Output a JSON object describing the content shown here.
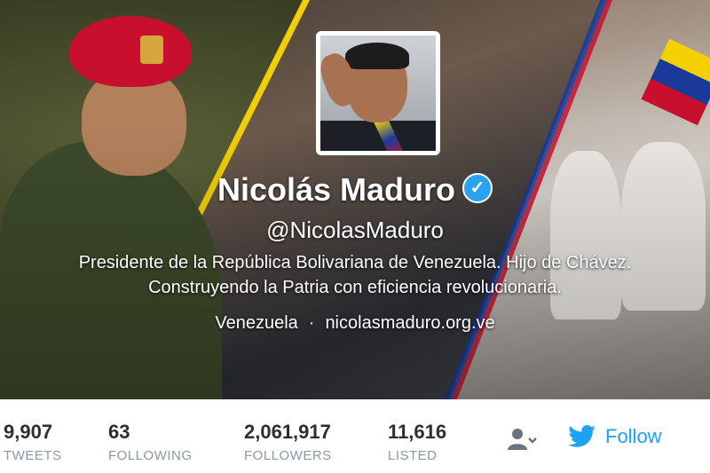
{
  "profile": {
    "name": "Nicolás Maduro",
    "verified_icon": "✓",
    "handle": "@NicolasMaduro",
    "bio_line1": "Presidente de la República Bolivariana de Venezuela. Hijo de Chávez.",
    "bio_line2": "Construyendo la Patria con eficiencia revolucionaria.",
    "location": "Venezuela",
    "separator": "·",
    "website": "nicolasmaduro.org.ve"
  },
  "stats": [
    {
      "value": "9,907",
      "label": "TWEETS"
    },
    {
      "value": "63",
      "label": "FOLLOWING"
    },
    {
      "value": "2,061,917",
      "label": "FOLLOWERS"
    },
    {
      "value": "11,616",
      "label": "LISTED"
    }
  ],
  "actions": {
    "follow_label": "Follow",
    "user_actions_icon": "user-actions-icon",
    "bird_icon": "twitter-bird-icon"
  },
  "colors": {
    "accent": "#1da1f2",
    "verified": "#2aa3ef",
    "stat_number": "#292f33",
    "stat_label": "#8899a6"
  }
}
